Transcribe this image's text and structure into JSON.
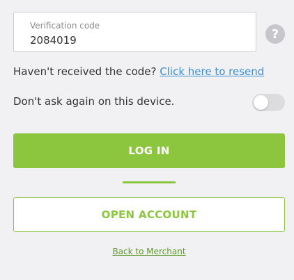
{
  "verification": {
    "label": "Verification code",
    "value": "2084019",
    "help_icon": "question-mark-icon"
  },
  "resend": {
    "prompt": "Haven't received the code?",
    "link_text": "Click here to resend"
  },
  "remember_device": {
    "label": "Don't ask again on this device.",
    "enabled": false
  },
  "actions": {
    "login_label": "LOG IN",
    "open_account_label": "OPEN ACCOUNT",
    "back_link": "Back to Merchant"
  },
  "colors": {
    "accent": "#8cc63f",
    "link": "#3a8fd6",
    "background": "#f1f1f3"
  }
}
